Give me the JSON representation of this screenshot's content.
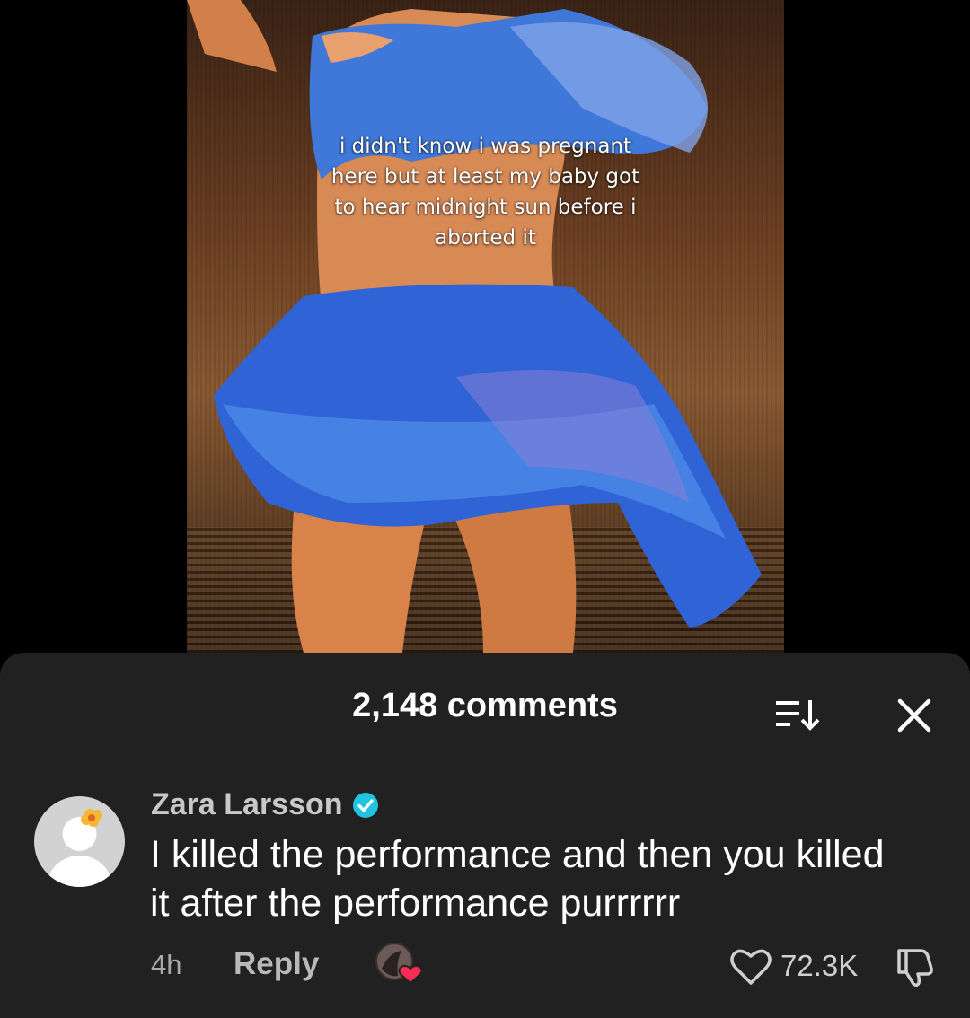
{
  "video": {
    "caption": "i didn't know i was pregnant here but at least my baby got to hear midnight sun before i aborted it"
  },
  "comments_sheet": {
    "title": "2,148 comments",
    "sort_icon": "sort-descending-icon",
    "close_icon": "close-icon"
  },
  "comment": {
    "author": "Zara Larsson",
    "verified": true,
    "text": "I killed the performance and then you killed it after the performance purrrrrr",
    "time": "4h",
    "reply_label": "Reply",
    "like_count": "72.3K"
  },
  "colors": {
    "sheet_bg": "#212121",
    "verified_badge": "#20c4e0",
    "creator_heart": "#fe2c55"
  }
}
